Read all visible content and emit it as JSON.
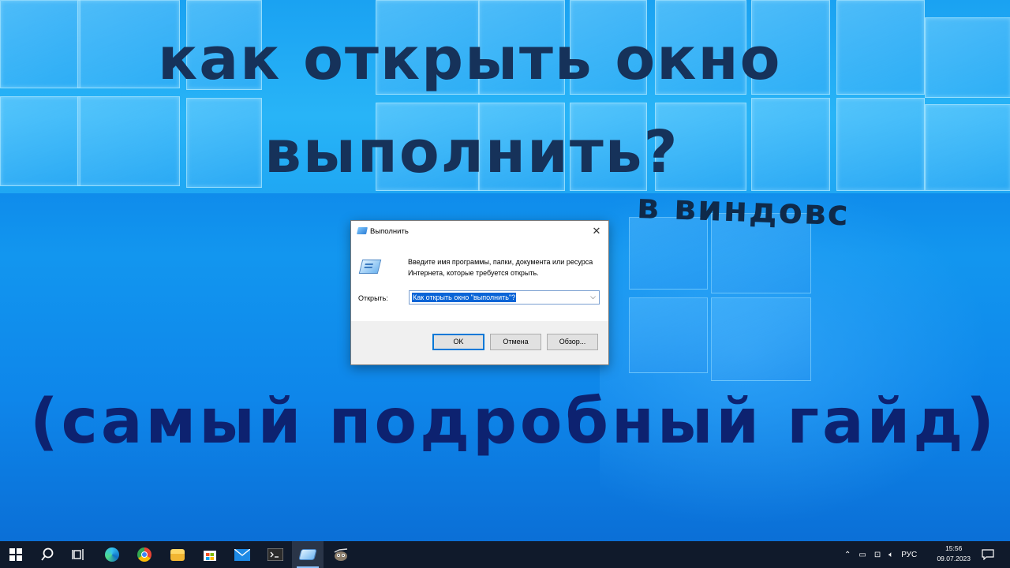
{
  "headline": {
    "line1": "как открыть окно",
    "line2": "выполнить?",
    "line3": "в виндовс",
    "line4": "(самый подробный гайд)"
  },
  "run_dialog": {
    "title": "Выполнить",
    "description": "Введите имя программы, папки, документа или ресурса Интернета, которые требуется открыть.",
    "open_label": "Открыть:",
    "open_value": "Как открыть окно \"выполнить\"?",
    "ok_label": "OK",
    "cancel_label": "Отмена",
    "browse_label": "Обзор..."
  },
  "taskbar": {
    "icons": [
      "windows-start",
      "search",
      "task-view",
      "edge",
      "chrome",
      "file-explorer",
      "store",
      "mail",
      "terminal",
      "run",
      "gimp"
    ],
    "language": "РУС",
    "time": "15:56",
    "date": "09.07.2023"
  },
  "colors": {
    "headline": "#16325a",
    "subheadline": "#0d2270",
    "taskbar_bg": "#101a2b",
    "accent": "#0078d7"
  }
}
